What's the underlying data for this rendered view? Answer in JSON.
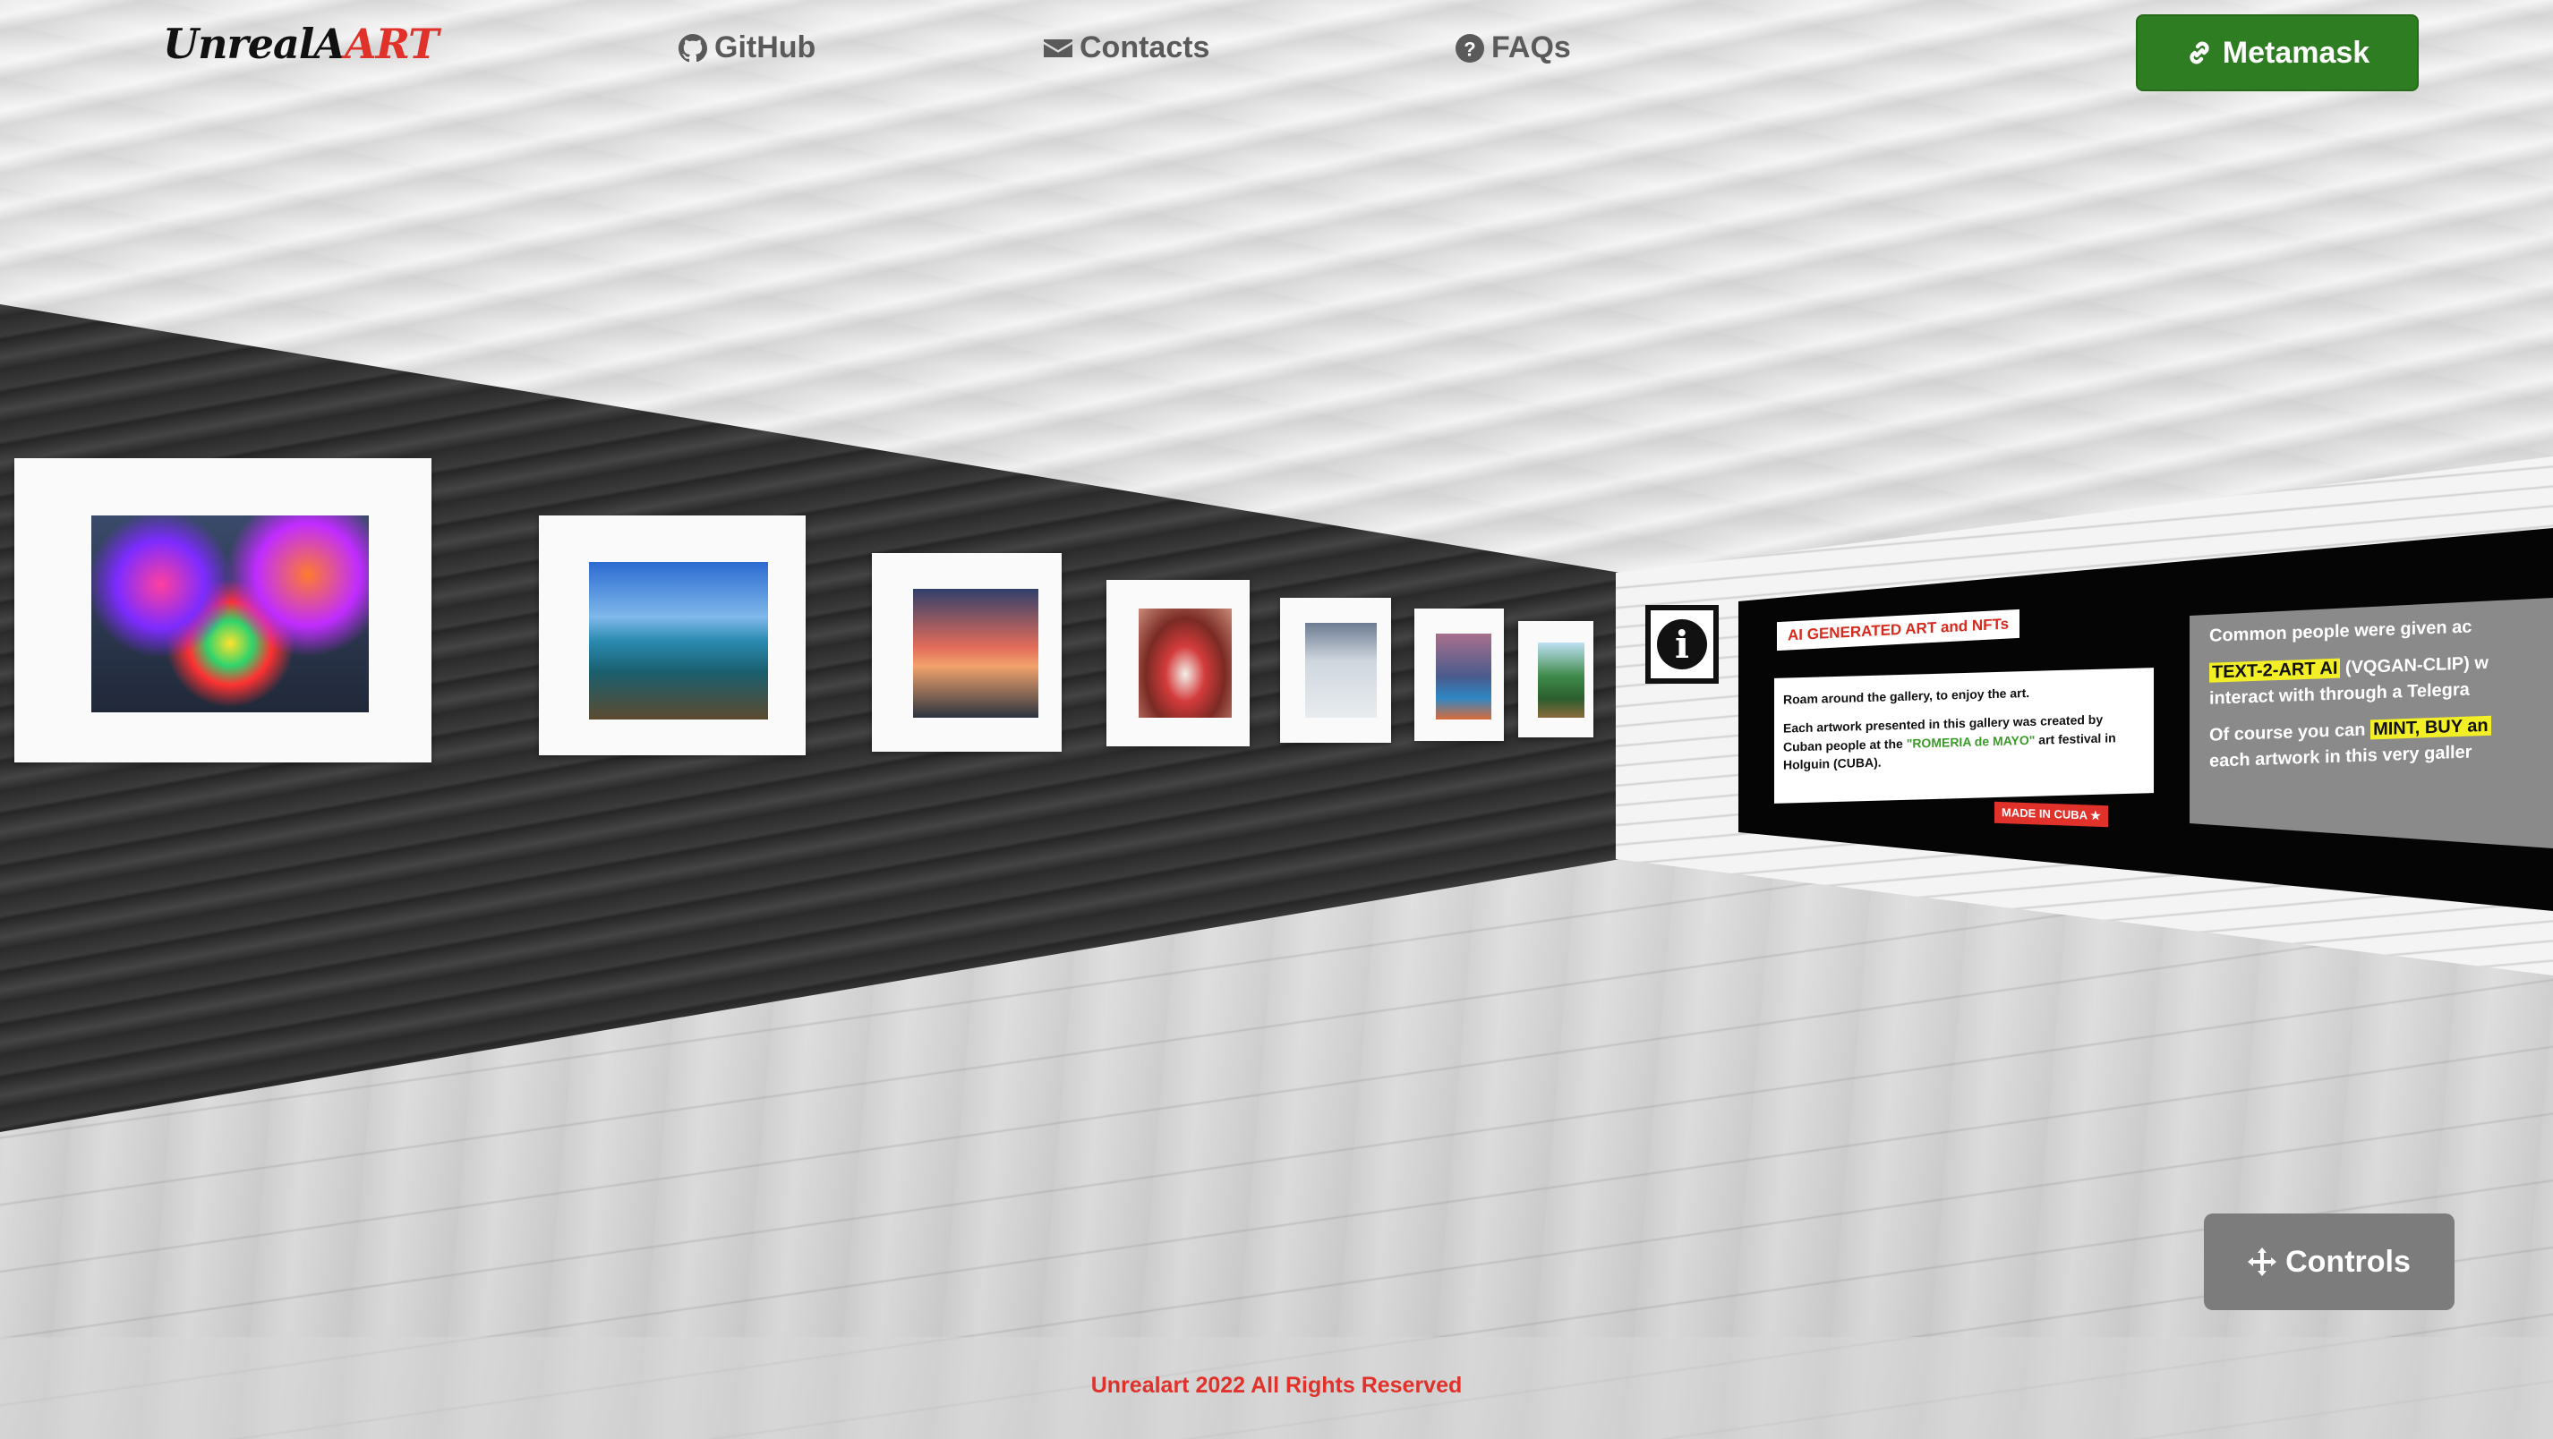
{
  "header": {
    "logo_part1": "UnrealA",
    "logo_part2": "ART",
    "nav": [
      {
        "label": "GitHub",
        "icon": "github-icon"
      },
      {
        "label": "Contacts",
        "icon": "envelope-icon"
      },
      {
        "label": "FAQs",
        "icon": "question-circle-icon"
      }
    ],
    "metamask_label": "Metamask"
  },
  "gallery": {
    "panel_title": "AI GENERATED ART and NFTs",
    "card_line1": "Roam around the gallery, to enjoy the art.",
    "card_line2_a": "Each artwork presented in this gallery was created by Cuban people at the ",
    "card_line2_b": "\"ROMERIA de MAYO\"",
    "card_line2_c": " art festival in Holguin (CUBA).",
    "made_in": "MADE IN CUBA ★",
    "info_text_1": "Common people were given ac",
    "info_text_2a": "TEXT-2-ART AI",
    "info_text_2b": " (VQGAN-CLIP) w",
    "info_text_3": "interact with through a Telegra",
    "info_text_4a": "Of course you can ",
    "info_text_4b": "MINT, BUY an",
    "info_text_5": "each artwork in this very galler"
  },
  "controls_label": "Controls",
  "footer_text": "Unrealart 2022 All Rights Reserved",
  "colors": {
    "accent_red": "#e0312a",
    "metamask_green": "#2f7d22",
    "controls_grey": "#7c7c7c"
  }
}
